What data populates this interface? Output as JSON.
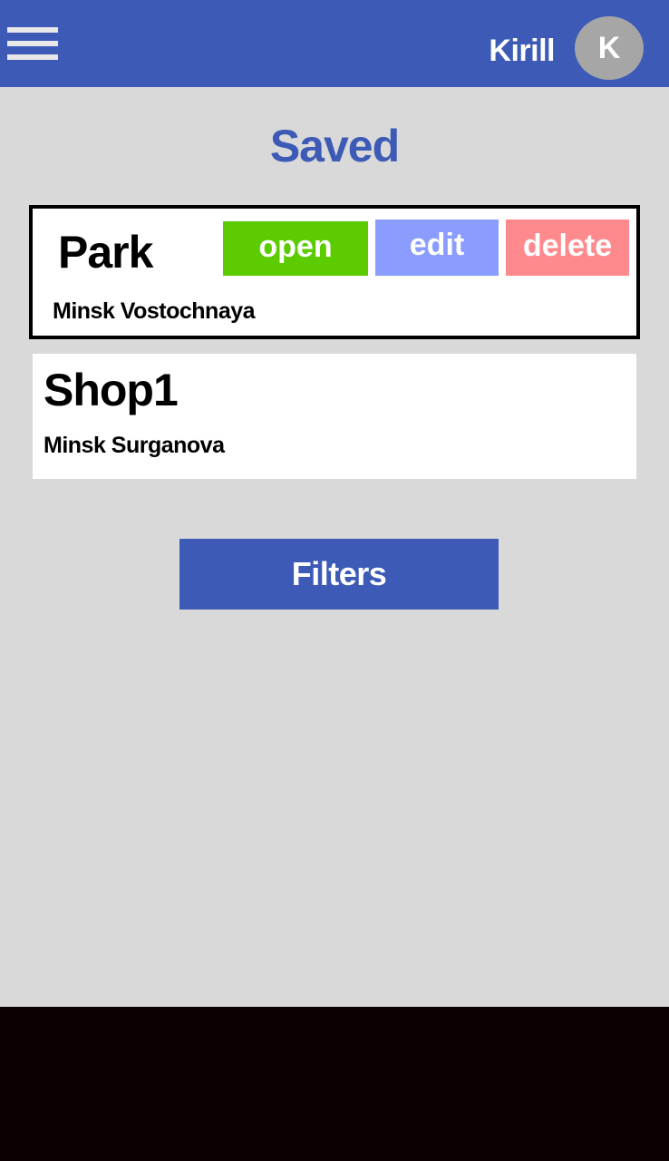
{
  "header": {
    "menu_icon": "hamburger-menu-icon",
    "user_name": "Kirill",
    "avatar_letter": "K",
    "colors": {
      "background": "#3c5ab6",
      "avatar": "#a6a6a6"
    }
  },
  "page": {
    "title": "Saved"
  },
  "saved_items": [
    {
      "name": "Park",
      "address": "Minsk Vostochnaya",
      "selected": true,
      "actions": {
        "open": "open",
        "edit": "edit",
        "delete": "delete"
      }
    },
    {
      "name": "Shop1",
      "address": "Minsk Surganova",
      "selected": false
    }
  ],
  "filters": {
    "label": "Filters"
  },
  "colors": {
    "accent": "#3c5ab6",
    "open_button": "#5ccc00",
    "edit_button": "#8a9dff",
    "delete_button": "#ff8a8e",
    "background": "#d9d9d9"
  }
}
